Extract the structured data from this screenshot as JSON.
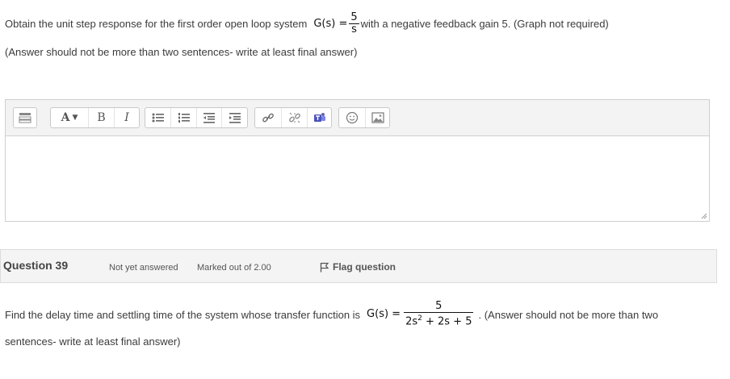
{
  "question_prev": {
    "text_before": "Obtain the unit step response for the first order open loop system",
    "formula_lhs": "G(s) =",
    "formula_num": "5",
    "formula_den": "s",
    "text_after": "with a negative feedback gain 5. (Graph not required)",
    "note": "(Answer should not be more than two sentences- write at least final answer)"
  },
  "editor": {
    "toolbar_icons": [
      "toolbar-toggle-icon",
      "font-color-icon",
      "bold-icon",
      "italic-icon",
      "unordered-list-icon",
      "ordered-list-icon",
      "outdent-icon",
      "indent-icon",
      "link-icon",
      "unlink-icon",
      "teams-icon",
      "emoticon-icon",
      "image-icon"
    ],
    "font_label": "A",
    "bold_label": "B",
    "italic_label": "I"
  },
  "question_header": {
    "number_label": "Question 39",
    "status": "Not yet answered",
    "marks": "Marked out of 2.00",
    "flag_label": "Flag question"
  },
  "question_current": {
    "text_before": "Find the delay time and settling time of the system whose transfer function is",
    "formula_lhs": "G(s) =",
    "formula_num": "5",
    "formula_den_a": "2s",
    "formula_den_exp": "2",
    "formula_den_b": " + 2s + 5",
    "text_after": ". (Answer should not be more than two",
    "text_line2": "sentences- write at least final answer)"
  }
}
